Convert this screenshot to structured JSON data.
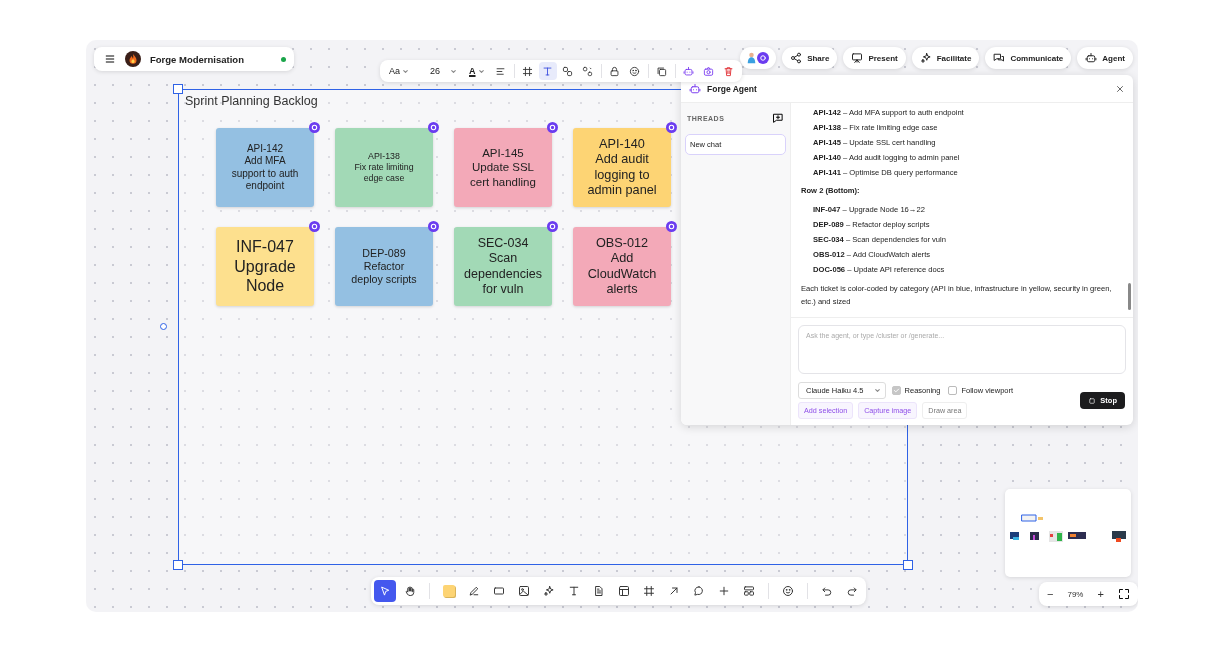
{
  "project": {
    "title": "Forge Modernisation",
    "online": true
  },
  "format_toolbar": {
    "font_label": "Aa",
    "font_size": "26",
    "color_label": "A",
    "items": [
      {
        "kind": "align",
        "selected": false
      },
      {
        "kind": "frame",
        "selected": false
      },
      {
        "kind": "text",
        "selected": true
      },
      {
        "kind": "link",
        "selected": false
      },
      {
        "kind": "unlink",
        "selected": false
      },
      {
        "kind": "lock",
        "selected": false
      },
      {
        "kind": "emoji",
        "selected": false
      },
      {
        "kind": "copy",
        "selected": false
      },
      {
        "kind": "robot",
        "selected": false
      },
      {
        "kind": "camera",
        "selected": false
      },
      {
        "kind": "delete",
        "selected": false
      }
    ]
  },
  "header_buttons": [
    {
      "label": "Share",
      "kind": "share"
    },
    {
      "label": "Present",
      "kind": "present"
    },
    {
      "label": "Facilitate",
      "kind": "sparkle"
    },
    {
      "label": "Communicate",
      "kind": "chat"
    },
    {
      "label": "Agent",
      "kind": "robot"
    }
  ],
  "frame": {
    "title": "Sprint Planning Backlog",
    "selected": true
  },
  "stickies": [
    {
      "text": "API-142\nAdd MFA\nsupport to auth\nendpoint",
      "color": "#94c0e2"
    },
    {
      "text": "API-138\nFix rate limiting\nedge case",
      "color": "#a2d9b6"
    },
    {
      "text": "API-145\nUpdate SSL\ncert handling",
      "color": "#f3a9b8"
    },
    {
      "text": "API-140\nAdd audit\nlogging to\nadmin panel",
      "color": "#fdd474"
    },
    {
      "text": "INF-047\nUpgrade\nNode",
      "color": "#fde08e"
    },
    {
      "text": "DEP-089\nRefactor\ndeploy scripts",
      "color": "#94c0e2"
    },
    {
      "text": "SEC-034\nScan\ndependencies\nfor vuln",
      "color": "#a2d9b6"
    },
    {
      "text": "OBS-012\nAdd\nCloudWatch\nalerts",
      "color": "#f3a9b8"
    }
  ],
  "agent_panel": {
    "title": "Forge Agent",
    "threads_label": "THREADS",
    "threads": [
      {
        "label": "New chat",
        "selected": true
      }
    ],
    "messages": [
      {
        "kind": "item",
        "text": "**API-142** – Add MFA support to auth endpoint"
      },
      {
        "kind": "item",
        "text": "**API-138** – Fix rate limiting edge case"
      },
      {
        "kind": "item",
        "text": "**API-145** – Update SSL cert handling"
      },
      {
        "kind": "item",
        "text": "**API-140** – Add audit logging to admin panel"
      },
      {
        "kind": "item",
        "text": "**API-141** – Optimise DB query performance"
      },
      {
        "kind": "heading",
        "text": "Row 2 (Bottom):"
      },
      {
        "kind": "item",
        "text": "**INF-047** – Upgrade Node 16→22"
      },
      {
        "kind": "item",
        "text": "**DEP-089** – Refactor deploy scripts"
      },
      {
        "kind": "item",
        "text": "**SEC-034** – Scan dependencies for vuln"
      },
      {
        "kind": "item",
        "text": "**OBS-012** – Add CloudWatch alerts"
      },
      {
        "kind": "item",
        "text": "**DOC-056** – Update API reference docs"
      },
      {
        "kind": "paragraph",
        "text": "Each ticket is color-coded by category (API in blue, infrastructure in yellow, security in green, etc.) and sized"
      }
    ],
    "input": {
      "placeholder": "Ask the agent, or type /cluster or /generate..."
    },
    "model": "Claude Haiku 4.5",
    "options": [
      {
        "label": "Reasoning",
        "checked": true,
        "disabled": true
      },
      {
        "label": "Follow viewport",
        "checked": false,
        "disabled": false
      }
    ],
    "actions": [
      {
        "label": "Add selection",
        "kind": "accent"
      },
      {
        "label": "Capture image",
        "kind": "accent"
      },
      {
        "label": "Draw area",
        "kind": "plain"
      }
    ],
    "stop_label": "Stop"
  },
  "tools": [
    {
      "kind": "select",
      "selected": true
    },
    {
      "kind": "hand",
      "selected": false
    },
    {
      "kind": "sep"
    },
    {
      "kind": "sticky",
      "selected": false
    },
    {
      "kind": "pen",
      "selected": false
    },
    {
      "kind": "rect",
      "selected": false
    },
    {
      "kind": "image",
      "selected": false
    },
    {
      "kind": "sparkle",
      "selected": false
    },
    {
      "kind": "text",
      "selected": false
    },
    {
      "kind": "doc",
      "selected": false
    },
    {
      "kind": "table",
      "selected": false
    },
    {
      "kind": "frame",
      "selected": false
    },
    {
      "kind": "arrow",
      "selected": false
    },
    {
      "kind": "comment",
      "selected": false
    },
    {
      "kind": "plus",
      "selected": false
    },
    {
      "kind": "template",
      "selected": false
    },
    {
      "kind": "sep"
    },
    {
      "kind": "emoji",
      "selected": false
    },
    {
      "kind": "sep"
    },
    {
      "kind": "undo",
      "selected": false
    },
    {
      "kind": "redo",
      "selected": false
    }
  ],
  "zoom": {
    "minus": "−",
    "level": "79%",
    "plus": "+"
  }
}
